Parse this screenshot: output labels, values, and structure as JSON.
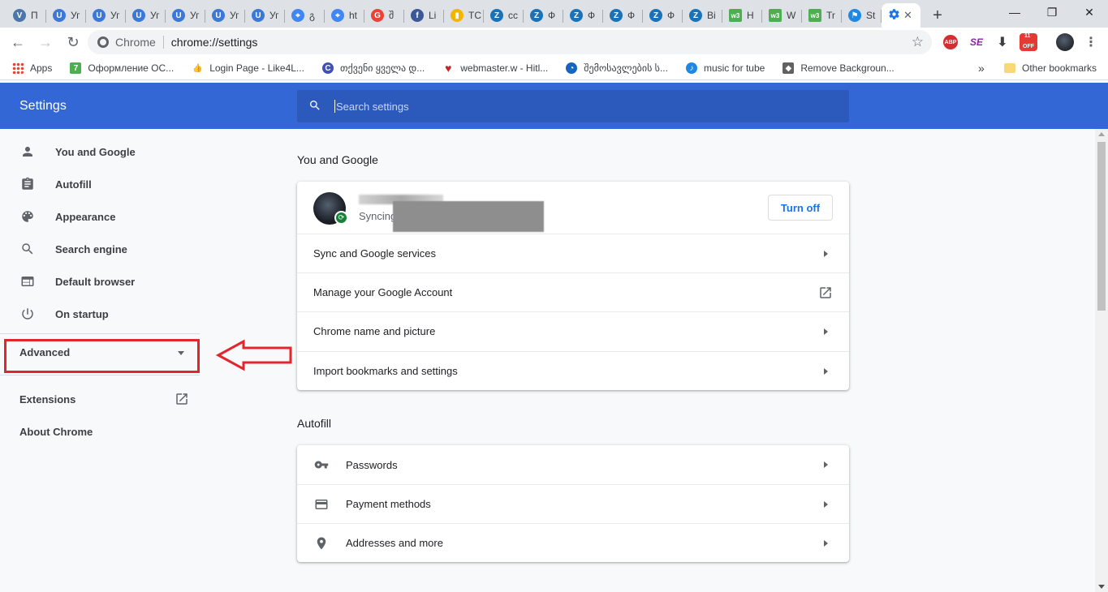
{
  "browser": {
    "tabs": [
      {
        "label": "П",
        "icon": "vk-style-icon",
        "color": "#4a76a8",
        "glyph": "V"
      },
      {
        "label": "Уг",
        "icon": "u-icon",
        "color": "#3c78d8",
        "glyph": "U"
      },
      {
        "label": "Уг",
        "icon": "u-icon",
        "color": "#3c78d8",
        "glyph": "U"
      },
      {
        "label": "Уг",
        "icon": "u-icon",
        "color": "#3c78d8",
        "glyph": "U"
      },
      {
        "label": "Уг",
        "icon": "u-icon",
        "color": "#3c78d8",
        "glyph": "U"
      },
      {
        "label": "Уг",
        "icon": "u-icon",
        "color": "#3c78d8",
        "glyph": "U"
      },
      {
        "label": "Уг",
        "icon": "u-icon",
        "color": "#3c78d8",
        "glyph": "U"
      },
      {
        "label": "გ",
        "icon": "location-pin-icon",
        "color": "#4285f4",
        "glyph": "⌖"
      },
      {
        "label": "ht",
        "icon": "location-pin-icon",
        "color": "#4285f4",
        "glyph": "⌖"
      },
      {
        "label": "შ",
        "icon": "google-icon",
        "color": "#ea4335",
        "glyph": "G"
      },
      {
        "label": "Li",
        "icon": "facebook-icon",
        "color": "#3b5998",
        "glyph": "f"
      },
      {
        "label": "TC",
        "icon": "chart-icon",
        "color": "#f4b400",
        "glyph": "▮"
      },
      {
        "label": "cc",
        "icon": "z-icon",
        "color": "#1a73b8",
        "glyph": "Z"
      },
      {
        "label": "Ф",
        "icon": "z-icon",
        "color": "#1a73b8",
        "glyph": "Z"
      },
      {
        "label": "Ф",
        "icon": "z-icon",
        "color": "#1a73b8",
        "glyph": "Z"
      },
      {
        "label": "Ф",
        "icon": "z-icon",
        "color": "#1a73b8",
        "glyph": "Z"
      },
      {
        "label": "Ф",
        "icon": "z-icon",
        "color": "#1a73b8",
        "glyph": "Z"
      },
      {
        "label": "Ві",
        "icon": "z-icon",
        "color": "#1a73b8",
        "glyph": "Z"
      },
      {
        "label": "H",
        "icon": "w3-icon",
        "color": "#4caf50",
        "glyph": "w3"
      },
      {
        "label": "W",
        "icon": "w3-icon",
        "color": "#4caf50",
        "glyph": "w3"
      },
      {
        "label": "Tr",
        "icon": "w3-icon",
        "color": "#4caf50",
        "glyph": "w3"
      },
      {
        "label": "St",
        "icon": "flag-icon",
        "color": "#1e88e5",
        "glyph": "⚑"
      }
    ],
    "active_tab": {
      "label": "",
      "icon": "gear-icon"
    },
    "address": {
      "chip": "Chrome",
      "url": "chrome://settings"
    },
    "extensions": {
      "abp": "ABP",
      "off": "OFF",
      "off_count": "11"
    },
    "bookmarks": [
      {
        "label": "Apps",
        "icon": "apps-grid-icon",
        "color": "#e94235"
      },
      {
        "label": "Оформление ОС...",
        "icon": "seven-icon",
        "color": "#4caf50",
        "glyph": "7"
      },
      {
        "label": "Login Page - Like4L...",
        "icon": "thumbs-up-icon",
        "color": "#3b78e7",
        "glyph": "👍"
      },
      {
        "label": "თქვენი ყველა დ...",
        "icon": "c-icon",
        "color": "#3f51b5",
        "glyph": "C"
      },
      {
        "label": "webmaster.w - Hitl...",
        "icon": "heart-icon",
        "color": "#c62828",
        "glyph": "♥"
      },
      {
        "label": "შემოსავლების ს...",
        "icon": "swirl-icon",
        "color": "#1565c0",
        "glyph": "◔"
      },
      {
        "label": "music for tube",
        "icon": "music-icon",
        "color": "#1e88e5",
        "glyph": "♪"
      },
      {
        "label": "Remove Backgroun...",
        "icon": "layers-icon",
        "color": "#616161",
        "glyph": "◆"
      }
    ],
    "overflow": "»",
    "other_bookmarks": "Other bookmarks"
  },
  "settings": {
    "title": "Settings",
    "search_placeholder": "Search settings",
    "sidebar": [
      {
        "label": "You and Google",
        "icon": "person-icon"
      },
      {
        "label": "Autofill",
        "icon": "clipboard-icon"
      },
      {
        "label": "Appearance",
        "icon": "palette-icon"
      },
      {
        "label": "Search engine",
        "icon": "search-icon"
      },
      {
        "label": "Default browser",
        "icon": "browser-window-icon"
      },
      {
        "label": "On startup",
        "icon": "power-icon"
      }
    ],
    "advanced": "Advanced",
    "extensions": "Extensions",
    "about": "About Chrome",
    "you_and_google": {
      "title": "You and Google",
      "syncing": "Syncing",
      "turn_off": "Turn off",
      "rows": [
        {
          "label": "Sync and Google services",
          "action": "chevron"
        },
        {
          "label": "Manage your Google Account",
          "action": "open-in-new"
        },
        {
          "label": "Chrome name and picture",
          "action": "chevron"
        },
        {
          "label": "Import bookmarks and settings",
          "action": "chevron"
        }
      ]
    },
    "autofill": {
      "title": "Autofill",
      "rows": [
        {
          "label": "Passwords",
          "icon": "key-icon"
        },
        {
          "label": "Payment methods",
          "icon": "credit-card-icon"
        },
        {
          "label": "Addresses and more",
          "icon": "location-pin-icon"
        }
      ]
    }
  },
  "colors": {
    "header_blue": "#3367d6",
    "annotation_red": "#e3262d",
    "link_blue": "#1a73e8"
  }
}
